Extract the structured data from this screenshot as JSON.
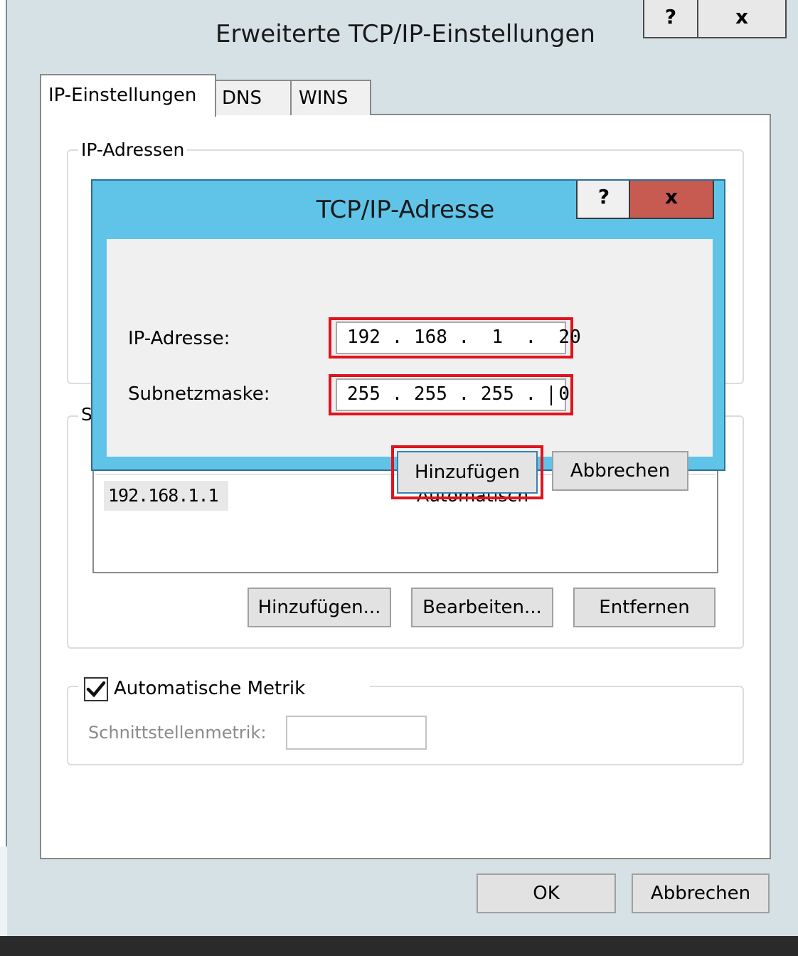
{
  "outer_dialog": {
    "title": "Erweiterte TCP/IP-Einstellungen",
    "help_label": "?",
    "close_label": "x",
    "tabs": [
      {
        "label": "IP-Einstellungen",
        "selected": true
      },
      {
        "label": "DNS",
        "selected": false
      },
      {
        "label": "WINS",
        "selected": false
      }
    ],
    "ip_group_label": "IP-Adressen",
    "gateway_group_label": "S",
    "gateways": [
      {
        "gateway": "192.168.1.1",
        "metric": "Automatisch"
      }
    ],
    "gateway_buttons": {
      "add": "Hinzufügen...",
      "edit": "Bearbeiten...",
      "remove": "Entfernen"
    },
    "auto_metric_label": "Automatische Metrik",
    "auto_metric_checked": true,
    "interface_metric_label": "Schnittstellenmetrik:",
    "interface_metric_value": "",
    "ok_label": "OK",
    "cancel_label": "Abbrechen"
  },
  "inner_dialog": {
    "title": "TCP/IP-Adresse",
    "help_label": "?",
    "close_label": "x",
    "ip_label": "IP-Adresse:",
    "ip_value": "192 . 168 .  1  .  20",
    "subnet_label": "Subnetzmaske:",
    "subnet_value": "255 . 255 . 255 .  0",
    "add_label": "Hinzufügen",
    "cancel_label": "Abbrechen"
  },
  "colors": {
    "highlight": "#e0141e",
    "inner_title_bar": "#5fc4e8",
    "inner_close": "#c75b52",
    "check": "✔"
  }
}
